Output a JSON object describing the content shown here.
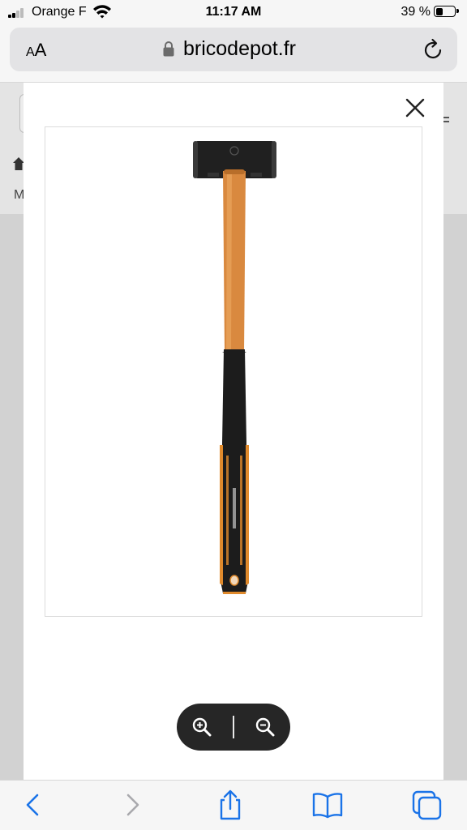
{
  "status_bar": {
    "carrier": "Orange F",
    "time": "11:17 AM",
    "battery_percent": "39 %",
    "battery_level": 0.39,
    "signal_bars": 2,
    "icons": [
      "signal-icon",
      "wifi-icon",
      "battery-icon"
    ]
  },
  "address_bar": {
    "text_size_label_small": "A",
    "text_size_label_large": "A",
    "url": "bricodepot.fr",
    "icons": [
      "lock-icon",
      "reload-icon"
    ]
  },
  "background_page": {
    "visible_letter": "M"
  },
  "modal": {
    "icons": [
      "close-icon",
      "zoom-in-icon",
      "zoom-out-icon"
    ],
    "product_image": "sledgehammer",
    "colors": {
      "handle_wood": "#d9893f",
      "grip_black": "#1c1c1c",
      "accent_orange": "#e08a2c",
      "zoom_pill_bg": "#262626"
    }
  },
  "toolbar": {
    "icons": [
      "back-icon",
      "forward-icon",
      "share-icon",
      "bookmarks-icon",
      "tabs-icon"
    ],
    "accent_color": "#1a73e8"
  }
}
